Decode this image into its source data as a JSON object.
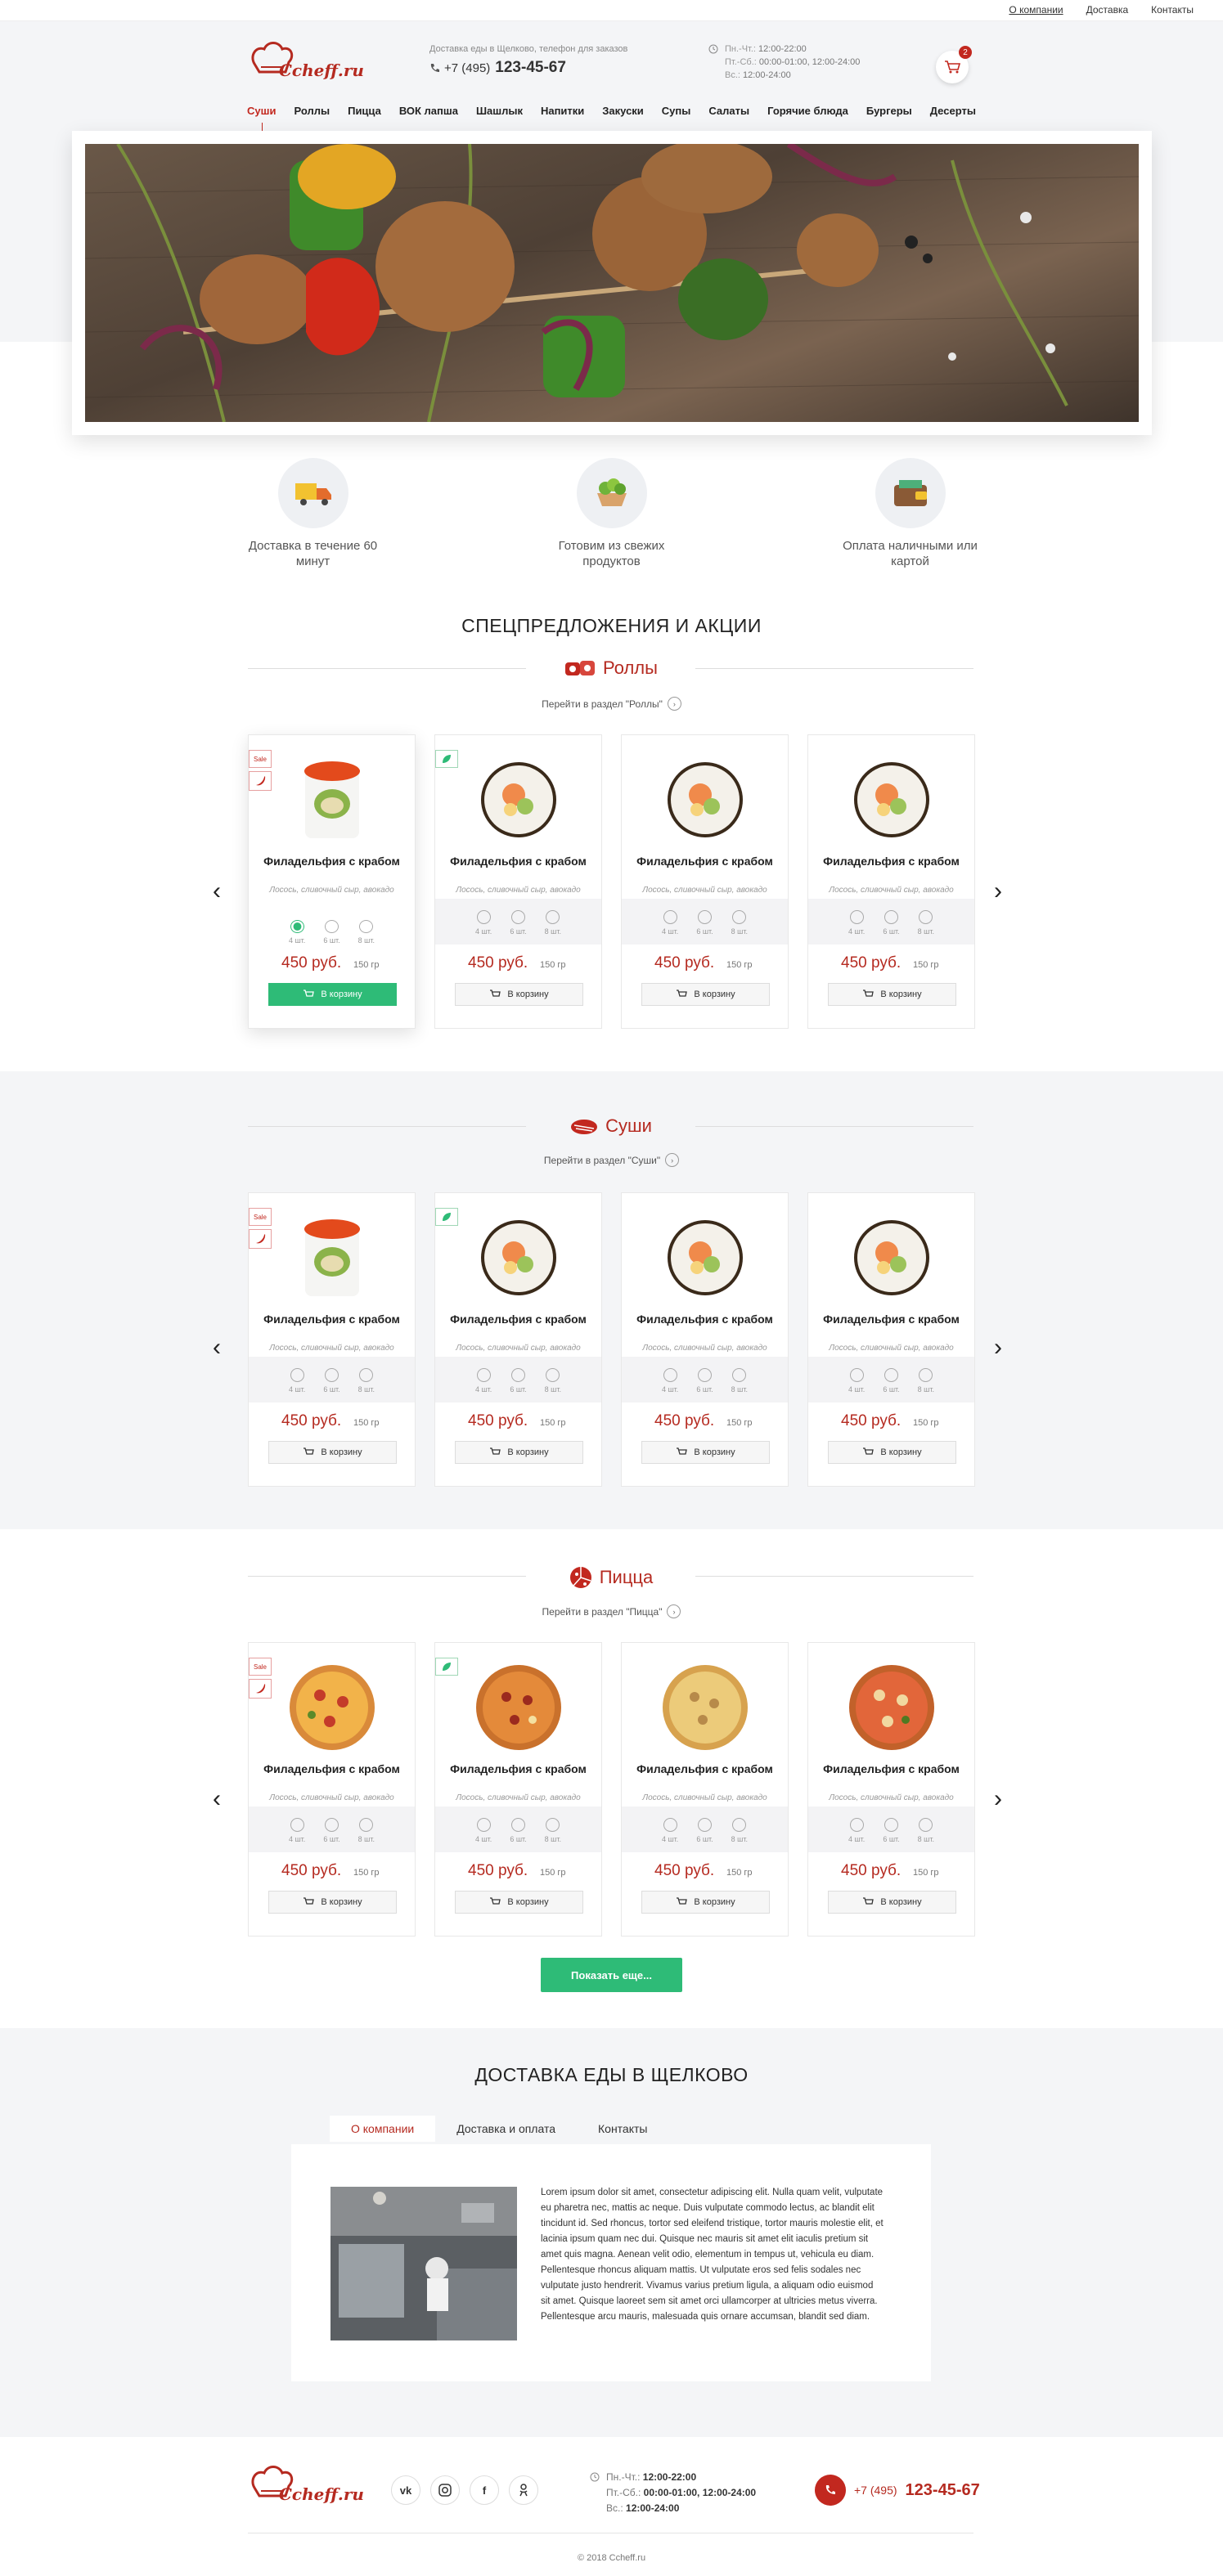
{
  "topbar": {
    "links": [
      "О компании",
      "Доставка",
      "Контакты"
    ]
  },
  "header": {
    "logo_text": "Ccheff.ru",
    "delivery_info": "Доставка еды в Щелково, телефон для заказов",
    "phone_prefix": "+7 (495)",
    "phone_number": "123-45-67",
    "hours": [
      {
        "label": "Пн.-Чт.:",
        "value": "12:00-22:00"
      },
      {
        "label": "Пт.-Сб.:",
        "value": "00:00-01:00, 12:00-24:00"
      },
      {
        "label": "Вс.:",
        "value": "12:00-24:00"
      }
    ],
    "cart_count": "2"
  },
  "nav": [
    "Суши",
    "Роллы",
    "Пицца",
    "ВОК лапша",
    "Шашлык",
    "Напитки",
    "Закуски",
    "Супы",
    "Салаты",
    "Горячие блюда",
    "Бургеры",
    "Десерты"
  ],
  "features": [
    {
      "icon": "delivery-truck-icon",
      "text": "Доставка в течение 60 минут"
    },
    {
      "icon": "fresh-food-icon",
      "text": "Готовим из свежих продуктов"
    },
    {
      "icon": "wallet-icon",
      "text": "Оплата наличными или картой"
    }
  ],
  "specials_title": "СПЕЦПРЕДЛОЖЕНИЯ И АКЦИИ",
  "categories": [
    {
      "name": "Роллы",
      "link": "Перейти в раздел \"Роллы\""
    },
    {
      "name": "Суши",
      "link": "Перейти в раздел \"Суши\""
    },
    {
      "name": "Пицца",
      "link": "Перейти в раздел \"Пицца\""
    }
  ],
  "product": {
    "name": "Филадельфия с крабом",
    "desc": "Лосось, сливочный сыр, авокадо",
    "options": [
      "4 шт.",
      "6 шт.",
      "8 шт."
    ],
    "price": "450 руб.",
    "weight": "150 гр",
    "button": "В корзину",
    "sale": "Sale"
  },
  "show_more": "Показать еще...",
  "about": {
    "title": "ДОСТАВКА ЕДЫ В ЩЕЛКОВО",
    "tabs": [
      "О компании",
      "Доставка и оплата",
      "Контакты"
    ],
    "text": "Lorem ipsum dolor sit amet, consectetur adipiscing elit. Nulla quam velit, vulputate eu pharetra nec, mattis ac neque. Duis vulputate commodo lectus, ac blandit elit tincidunt id. Sed rhoncus, tortor sed eleifend tristique, tortor mauris molestie elit, et lacinia ipsum quam nec dui. Quisque nec mauris sit amet elit iaculis pretium sit amet quis magna. Aenean velit odio, elementum in tempus ut, vehicula eu diam. Pellentesque rhoncus aliquam mattis. Ut vulputate eros sed felis sodales nec vulputate justo hendrerit. Vivamus varius pretium ligula, a aliquam odio euismod sit amet. Quisque laoreet sem sit amet orci ullamcorper at ultricies metus viverra. Pellentesque arcu mauris, malesuada quis ornare accumsan, blandit sed diam."
  },
  "footer": {
    "hours": [
      {
        "label": "Пн.-Чт.:",
        "value": "12:00-22:00"
      },
      {
        "label": "Пт.-Сб.:",
        "value": "00:00-01:00, 12:00-24:00"
      },
      {
        "label": "Вс.:",
        "value": "12:00-24:00"
      }
    ],
    "phone_prefix": "+7 (495)",
    "phone_number": "123-45-67",
    "copyright": "© 2018 Ccheff.ru"
  },
  "colors": {
    "accent": "#b52a20",
    "green": "#2ebb77",
    "gray_bg": "#f4f5f7"
  }
}
